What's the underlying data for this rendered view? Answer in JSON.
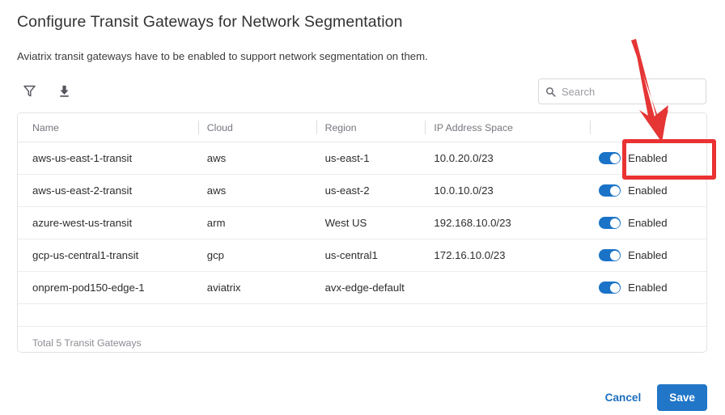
{
  "header": {
    "title": "Configure Transit Gateways for Network Segmentation",
    "subtitle": "Aviatrix transit gateways have to be enabled to support network segmentation on them."
  },
  "toolbar": {
    "filter_icon": "filter-icon",
    "download_icon": "download-icon"
  },
  "search": {
    "icon": "search-icon",
    "placeholder": "Search",
    "value": ""
  },
  "table": {
    "columns": [
      {
        "key": "name",
        "label": "Name"
      },
      {
        "key": "cloud",
        "label": "Cloud"
      },
      {
        "key": "region",
        "label": "Region"
      },
      {
        "key": "ip",
        "label": "IP Address Space"
      },
      {
        "key": "status",
        "label": ""
      }
    ],
    "rows": [
      {
        "name": "aws-us-east-1-transit",
        "cloud": "aws",
        "region": "us-east-1",
        "ip": "10.0.20.0/23",
        "status_label": "Enabled",
        "status_on": true
      },
      {
        "name": "aws-us-east-2-transit",
        "cloud": "aws",
        "region": "us-east-2",
        "ip": "10.0.10.0/23",
        "status_label": "Enabled",
        "status_on": true
      },
      {
        "name": "azure-west-us-transit",
        "cloud": "arm",
        "region": "West US",
        "ip": "192.168.10.0/23",
        "status_label": "Enabled",
        "status_on": true
      },
      {
        "name": "gcp-us-central1-transit",
        "cloud": "gcp",
        "region": "us-central1",
        "ip": "172.16.10.0/23",
        "status_label": "Enabled",
        "status_on": true
      },
      {
        "name": "onprem-pod150-edge-1",
        "cloud": "aviatrix",
        "region": "avx-edge-default",
        "ip": "",
        "status_label": "Enabled",
        "status_on": true
      }
    ],
    "footer_text": "Total 5 Transit Gateways"
  },
  "actions": {
    "cancel_label": "Cancel",
    "save_label": "Save"
  },
  "annotation": {
    "arrow": "red-arrow",
    "highlight": "red-highlight-box",
    "color": "#ea3232"
  },
  "colors": {
    "accent_blue": "#2176c7",
    "toggle_on": "#1a73c7",
    "link_blue": "#1d6fbe",
    "annotation_red": "#ea3232"
  }
}
